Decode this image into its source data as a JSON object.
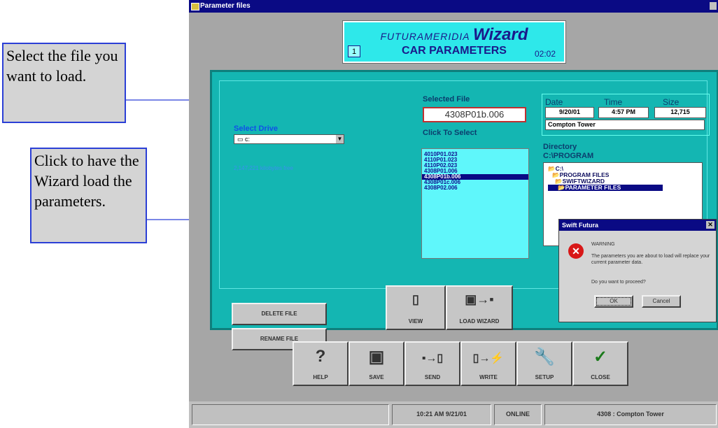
{
  "callouts": {
    "select_file": "Select the file you want to load.",
    "click_wizard": "Click to have the Wizard load the parameters."
  },
  "window": {
    "title": "Parameter files"
  },
  "header": {
    "brand1": "FUTURAMERIDIA",
    "brand2": "Wizard",
    "step": "1",
    "title": "CAR PARAMETERS",
    "time": "02:02"
  },
  "drive": {
    "label": "Select Drive",
    "value": "c:",
    "info": "2,147,221 kilobytes free"
  },
  "file": {
    "selected_label": "Selected File",
    "selected": "4308P01b.006",
    "click_label": "Click To Select",
    "list": [
      "4010P01.023",
      "4110P01.023",
      "4110P02.023",
      "4308P01.006",
      "4308P01b.006",
      "4308P01c.006",
      "4308P02.006"
    ]
  },
  "info": {
    "date_label": "Date",
    "time_label": "Time",
    "size_label": "Size",
    "date": "9/20/01",
    "time": "4:57 PM",
    "size": "12,715",
    "location": "Compton Tower"
  },
  "directory": {
    "label": "Directory",
    "path": "C:\\PROGRAM",
    "tree": [
      "C:\\",
      "PROGRAM FILES",
      "SWIFTWIZARD",
      "PARAMETER FILES"
    ]
  },
  "buttons": {
    "delete": "DELETE FILE",
    "rename": "RENAME FILE",
    "view": "VIEW",
    "load": "LOAD WIZARD"
  },
  "dialog": {
    "title": "Swift Futura",
    "warning": "WARNING",
    "message": "The parameters you are about to load will replace your current parameter data.",
    "question": "Do you want to proceed?",
    "ok": "OK",
    "cancel": "Cancel"
  },
  "toolbar": {
    "help": "HELP",
    "save": "SAVE",
    "send": "SEND",
    "write": "WRITE",
    "setup": "SETUP",
    "close": "CLOSE"
  },
  "status": {
    "datetime": "10:21 AM 9/21/01",
    "mode": "ONLINE",
    "site": "4308 : Compton Tower"
  },
  "colors": {
    "title_bar": "#0a0a84",
    "teal_panel": "#14b6b2",
    "header_cyan": "#2ee8ea",
    "callout_border": "#2b3fd6"
  }
}
